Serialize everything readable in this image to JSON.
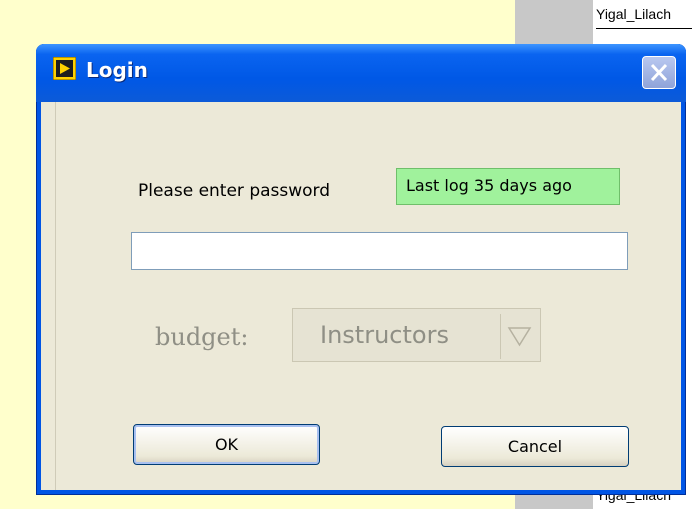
{
  "background": {
    "top_cell": "Yigal_Lilach",
    "bottom_cell": "Yigal_Lilach"
  },
  "window": {
    "title": "Login",
    "app_icon": "labview-vi-icon",
    "close_icon": "close-icon"
  },
  "form": {
    "prompt": "Please enter password",
    "status": "Last log 35 days ago",
    "password_value": "",
    "budget_label": "budget:",
    "budget_value": "Instructors",
    "ok_label": "OK",
    "cancel_label": "Cancel"
  },
  "colors": {
    "title_bar": "#0058e6",
    "status_bg": "#a0f29c",
    "client_bg": "#ece9d8"
  }
}
